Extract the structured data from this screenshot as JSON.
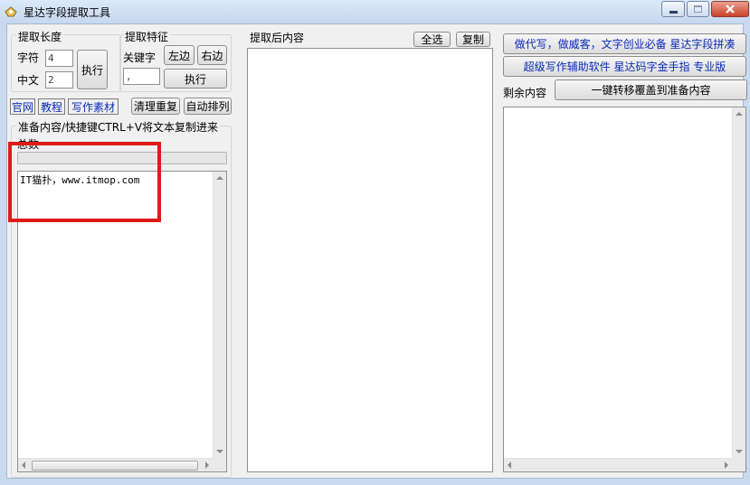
{
  "window": {
    "title": "星达字段提取工具",
    "icon": "app-logo-icon"
  },
  "left": {
    "group_length_title": "提取长度",
    "char_label": "字符",
    "char_value": "4",
    "chinese_label": "中文",
    "chinese_value": "2",
    "length_exec": "执行",
    "group_feature_title": "提取特征",
    "keyword_label": "关键字",
    "left_btn": "左边",
    "right_btn": "右边",
    "keyword_value": ",",
    "feature_exec": "执行",
    "link_official": "官网",
    "link_tutorial": "教程",
    "link_material": "写作素材",
    "clear_dup": "清理重复",
    "auto_sort": "自动排列",
    "prepare_title": "准备内容/快捷键CTRL+V将文本复制进来",
    "total_label": "总数",
    "progress": 0.0,
    "text_content": "IT猫扑，www.itmop.com"
  },
  "middle": {
    "title": "提取后内容",
    "select_all": "全选",
    "copy": "复制",
    "text_content": ""
  },
  "right": {
    "ad_line1": "做代写，做威客，文字创业必备 星达字段拼凑",
    "ad_line2": "超级写作辅助软件 星达码字金手指 专业版",
    "remaining_label": "剩余内容",
    "transfer_btn": "一键转移覆盖到准备内容",
    "text_content": ""
  },
  "colors": {
    "highlight_box": "#e01a1a",
    "link_blue": "#0a2bb5",
    "progress_green": "#06b025"
  }
}
